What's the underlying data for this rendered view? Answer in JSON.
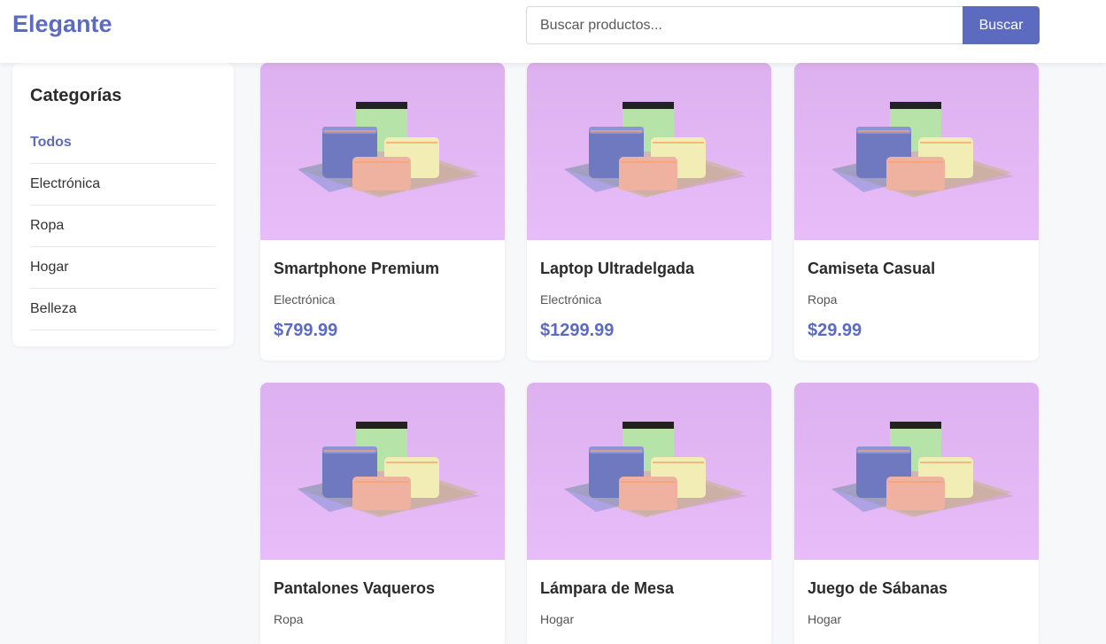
{
  "header": {
    "logo": "Elegante",
    "search_placeholder": "Buscar productos...",
    "search_value": "",
    "search_button": "Buscar"
  },
  "sidebar": {
    "title": "Categorías",
    "items": [
      {
        "label": "Todos",
        "active": true
      },
      {
        "label": "Electrónica",
        "active": false
      },
      {
        "label": "Ropa",
        "active": false
      },
      {
        "label": "Hogar",
        "active": false
      },
      {
        "label": "Belleza",
        "active": false
      }
    ]
  },
  "products": [
    {
      "name": "Smartphone Premium",
      "category": "Electrónica",
      "price": "$799.99"
    },
    {
      "name": "Laptop Ultradelgada",
      "category": "Electrónica",
      "price": "$1299.99"
    },
    {
      "name": "Camiseta Casual",
      "category": "Ropa",
      "price": "$29.99"
    },
    {
      "name": "Pantalones Vaqueros",
      "category": "Ropa",
      "price": ""
    },
    {
      "name": "Lámpara de Mesa",
      "category": "Hogar",
      "price": ""
    },
    {
      "name": "Juego de Sábanas",
      "category": "Hogar",
      "price": ""
    }
  ],
  "colors": {
    "accent": "#5c6bc0",
    "image_bg": "#e3b6f4"
  }
}
